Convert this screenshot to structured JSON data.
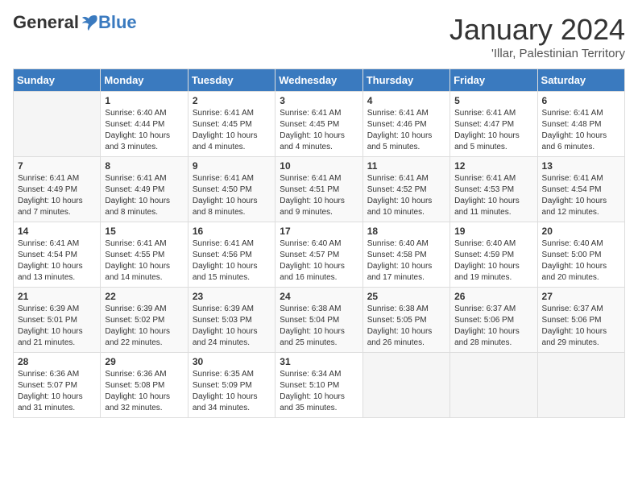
{
  "header": {
    "logo": {
      "general": "General",
      "blue": "Blue",
      "tagline": ""
    },
    "title": "January 2024",
    "location": "'Illar, Palestinian Territory"
  },
  "days_of_week": [
    "Sunday",
    "Monday",
    "Tuesday",
    "Wednesday",
    "Thursday",
    "Friday",
    "Saturday"
  ],
  "weeks": [
    [
      {
        "day": "",
        "info": ""
      },
      {
        "day": "1",
        "info": "Sunrise: 6:40 AM\nSunset: 4:44 PM\nDaylight: 10 hours\nand 3 minutes."
      },
      {
        "day": "2",
        "info": "Sunrise: 6:41 AM\nSunset: 4:45 PM\nDaylight: 10 hours\nand 4 minutes."
      },
      {
        "day": "3",
        "info": "Sunrise: 6:41 AM\nSunset: 4:45 PM\nDaylight: 10 hours\nand 4 minutes."
      },
      {
        "day": "4",
        "info": "Sunrise: 6:41 AM\nSunset: 4:46 PM\nDaylight: 10 hours\nand 5 minutes."
      },
      {
        "day": "5",
        "info": "Sunrise: 6:41 AM\nSunset: 4:47 PM\nDaylight: 10 hours\nand 5 minutes."
      },
      {
        "day": "6",
        "info": "Sunrise: 6:41 AM\nSunset: 4:48 PM\nDaylight: 10 hours\nand 6 minutes."
      }
    ],
    [
      {
        "day": "7",
        "info": "Sunrise: 6:41 AM\nSunset: 4:49 PM\nDaylight: 10 hours\nand 7 minutes."
      },
      {
        "day": "8",
        "info": "Sunrise: 6:41 AM\nSunset: 4:49 PM\nDaylight: 10 hours\nand 8 minutes."
      },
      {
        "day": "9",
        "info": "Sunrise: 6:41 AM\nSunset: 4:50 PM\nDaylight: 10 hours\nand 8 minutes."
      },
      {
        "day": "10",
        "info": "Sunrise: 6:41 AM\nSunset: 4:51 PM\nDaylight: 10 hours\nand 9 minutes."
      },
      {
        "day": "11",
        "info": "Sunrise: 6:41 AM\nSunset: 4:52 PM\nDaylight: 10 hours\nand 10 minutes."
      },
      {
        "day": "12",
        "info": "Sunrise: 6:41 AM\nSunset: 4:53 PM\nDaylight: 10 hours\nand 11 minutes."
      },
      {
        "day": "13",
        "info": "Sunrise: 6:41 AM\nSunset: 4:54 PM\nDaylight: 10 hours\nand 12 minutes."
      }
    ],
    [
      {
        "day": "14",
        "info": "Sunrise: 6:41 AM\nSunset: 4:54 PM\nDaylight: 10 hours\nand 13 minutes."
      },
      {
        "day": "15",
        "info": "Sunrise: 6:41 AM\nSunset: 4:55 PM\nDaylight: 10 hours\nand 14 minutes."
      },
      {
        "day": "16",
        "info": "Sunrise: 6:41 AM\nSunset: 4:56 PM\nDaylight: 10 hours\nand 15 minutes."
      },
      {
        "day": "17",
        "info": "Sunrise: 6:40 AM\nSunset: 4:57 PM\nDaylight: 10 hours\nand 16 minutes."
      },
      {
        "day": "18",
        "info": "Sunrise: 6:40 AM\nSunset: 4:58 PM\nDaylight: 10 hours\nand 17 minutes."
      },
      {
        "day": "19",
        "info": "Sunrise: 6:40 AM\nSunset: 4:59 PM\nDaylight: 10 hours\nand 19 minutes."
      },
      {
        "day": "20",
        "info": "Sunrise: 6:40 AM\nSunset: 5:00 PM\nDaylight: 10 hours\nand 20 minutes."
      }
    ],
    [
      {
        "day": "21",
        "info": "Sunrise: 6:39 AM\nSunset: 5:01 PM\nDaylight: 10 hours\nand 21 minutes."
      },
      {
        "day": "22",
        "info": "Sunrise: 6:39 AM\nSunset: 5:02 PM\nDaylight: 10 hours\nand 22 minutes."
      },
      {
        "day": "23",
        "info": "Sunrise: 6:39 AM\nSunset: 5:03 PM\nDaylight: 10 hours\nand 24 minutes."
      },
      {
        "day": "24",
        "info": "Sunrise: 6:38 AM\nSunset: 5:04 PM\nDaylight: 10 hours\nand 25 minutes."
      },
      {
        "day": "25",
        "info": "Sunrise: 6:38 AM\nSunset: 5:05 PM\nDaylight: 10 hours\nand 26 minutes."
      },
      {
        "day": "26",
        "info": "Sunrise: 6:37 AM\nSunset: 5:06 PM\nDaylight: 10 hours\nand 28 minutes."
      },
      {
        "day": "27",
        "info": "Sunrise: 6:37 AM\nSunset: 5:06 PM\nDaylight: 10 hours\nand 29 minutes."
      }
    ],
    [
      {
        "day": "28",
        "info": "Sunrise: 6:36 AM\nSunset: 5:07 PM\nDaylight: 10 hours\nand 31 minutes."
      },
      {
        "day": "29",
        "info": "Sunrise: 6:36 AM\nSunset: 5:08 PM\nDaylight: 10 hours\nand 32 minutes."
      },
      {
        "day": "30",
        "info": "Sunrise: 6:35 AM\nSunset: 5:09 PM\nDaylight: 10 hours\nand 34 minutes."
      },
      {
        "day": "31",
        "info": "Sunrise: 6:34 AM\nSunset: 5:10 PM\nDaylight: 10 hours\nand 35 minutes."
      },
      {
        "day": "",
        "info": ""
      },
      {
        "day": "",
        "info": ""
      },
      {
        "day": "",
        "info": ""
      }
    ]
  ]
}
